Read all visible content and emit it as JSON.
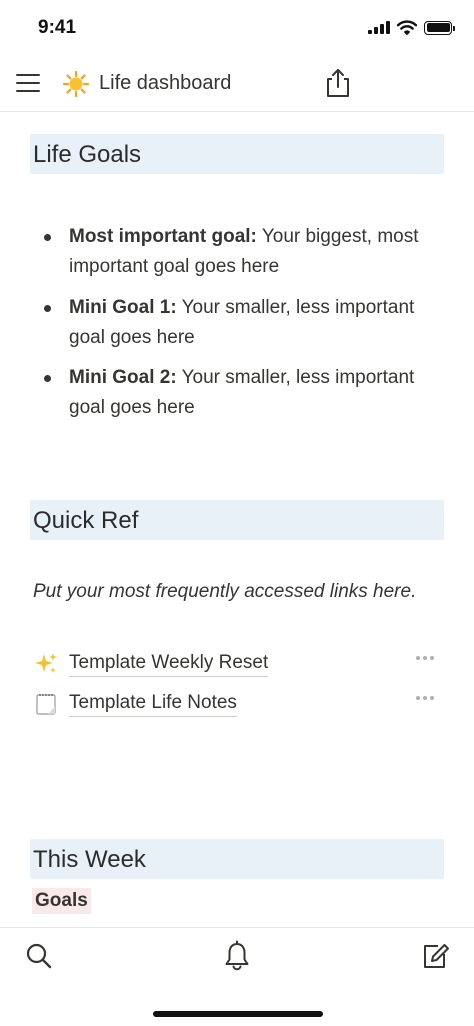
{
  "status_bar": {
    "time": "9:41"
  },
  "header": {
    "page_icon": "sun-emoji-icon",
    "title": "Life dashboard"
  },
  "sections": {
    "life_goals": {
      "heading": "Life Goals",
      "items": [
        {
          "label": "Most important goal:",
          "text": " Your biggest, most important goal goes here"
        },
        {
          "label": "Mini Goal 1:",
          "text": " Your smaller, less important goal goes here"
        },
        {
          "label": "Mini Goal 2:",
          "text": " Your smaller, less important goal goes here"
        }
      ]
    },
    "quick_ref": {
      "heading": "Quick Ref",
      "note": "Put your most frequently accessed links here.",
      "links": [
        {
          "icon": "sparkles-icon",
          "label": "Template Weekly Reset"
        },
        {
          "icon": "notepad-icon",
          "label": "Template Life Notes"
        }
      ]
    },
    "this_week": {
      "heading": "This Week",
      "tag": "Goals"
    }
  },
  "bottom_nav": {
    "items": [
      {
        "icon": "search-icon"
      },
      {
        "icon": "bell-icon"
      },
      {
        "icon": "compose-icon"
      }
    ]
  }
}
